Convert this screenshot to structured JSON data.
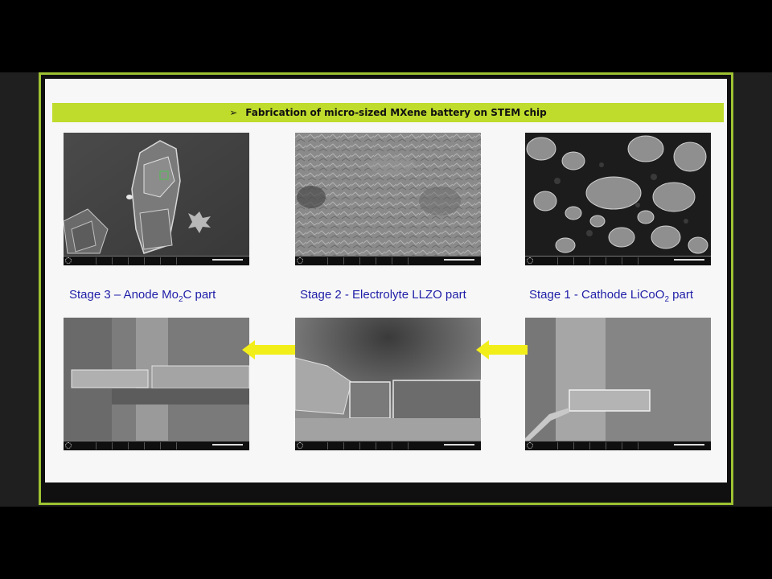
{
  "banner": {
    "title": "Fabrication of micro-sized MXene battery on STEM chip",
    "bullet_icon": "arrowhead-bullet-icon"
  },
  "captions": {
    "stage3": {
      "prefix": "Stage 3 – Anode Mo",
      "sub": "2",
      "suffix": "C part"
    },
    "stage2": {
      "text": "Stage 2 - Electrolyte LLZO part"
    },
    "stage1": {
      "prefix": "Stage 1 - Cathode LiCoO",
      "sub": "2",
      "suffix": " part"
    }
  },
  "colors": {
    "frame": "#9ec232",
    "banner": "#bfdc2c",
    "caption": "#1e1ea8",
    "arrow": "#f2ee1a"
  },
  "arrows": [
    "left-arrow-icon",
    "left-arrow-icon"
  ]
}
